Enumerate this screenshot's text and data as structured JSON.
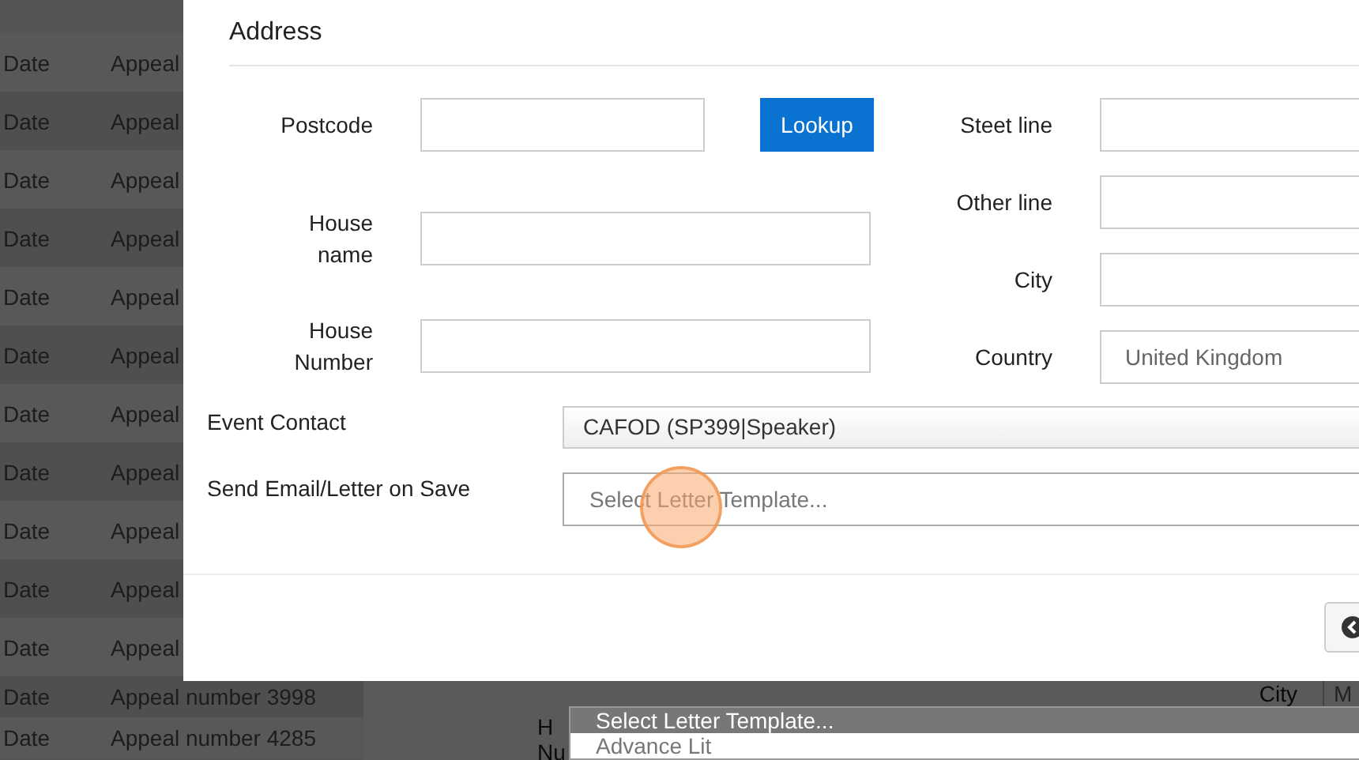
{
  "background_table": {
    "rows": [
      {
        "date": "Date",
        "appeal": "Appeal"
      },
      {
        "date": "Date",
        "appeal": "Appeal"
      },
      {
        "date": "Date",
        "appeal": "Appeal"
      },
      {
        "date": "Date",
        "appeal": "Appeal"
      },
      {
        "date": "Date",
        "appeal": "Appeal"
      },
      {
        "date": "Date",
        "appeal": "Appeal"
      },
      {
        "date": "Date",
        "appeal": "Appeal"
      },
      {
        "date": "Date",
        "appeal": "Appeal"
      },
      {
        "date": "Date",
        "appeal": "Appeal"
      },
      {
        "date": "Date",
        "appeal": "Appeal"
      },
      {
        "date": "Date",
        "appeal": "Appeal"
      },
      {
        "date": "Date",
        "appeal": "Appeal number 3998"
      },
      {
        "date": "Date",
        "appeal": "Appeal number 4285"
      }
    ]
  },
  "background_form": {
    "city_label": "City",
    "city_value": "M",
    "house_label_lines": [
      "H",
      "Nu"
    ]
  },
  "dialog": {
    "section_title": "Address",
    "left_fields": [
      {
        "label": "Postcode"
      },
      {
        "label": "House name"
      },
      {
        "label": "House Number"
      }
    ],
    "lookup_button": "Lookup",
    "right_fields": [
      {
        "label": "Steet line"
      },
      {
        "label": "Other line"
      },
      {
        "label": "City"
      },
      {
        "label": "Country",
        "value": "United Kingdom"
      }
    ],
    "event_contact": {
      "label": "Event Contact",
      "value": "CAFOD (SP399|Speaker)"
    },
    "send_email": {
      "label": "Send Email/Letter on Save",
      "placeholder": "Select Letter Template..."
    }
  },
  "dropdown": {
    "options": [
      {
        "label": "Select Letter Template...",
        "selected": true
      },
      {
        "label": "Advance Lit",
        "selected": false
      }
    ]
  }
}
